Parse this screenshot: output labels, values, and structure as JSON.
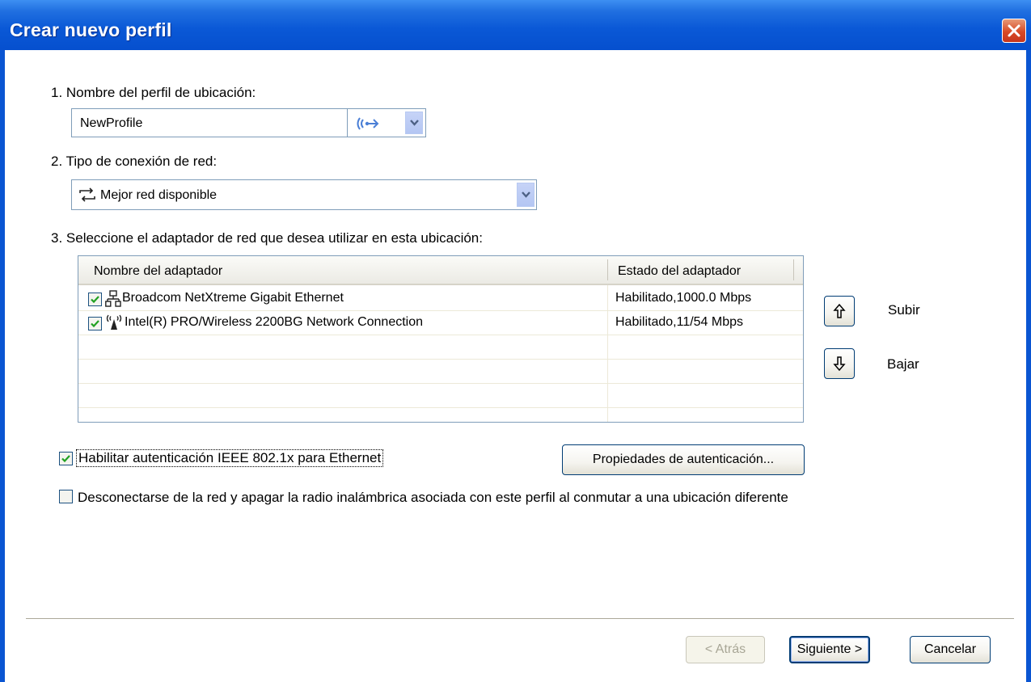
{
  "window": {
    "title": "Crear nuevo perfil"
  },
  "step1": {
    "label": "1. Nombre del perfil de ubicación:",
    "profile_name_value": "NewProfile",
    "icon_selection": "wireless-icon"
  },
  "step2": {
    "label": "2. Tipo de conexión de red:",
    "connection_type_value": "Mejor red disponible"
  },
  "step3": {
    "label": "3. Seleccione el adaptador de red que desea utilizar en esta ubicación:",
    "columns": [
      "Nombre del adaptador",
      "Estado del adaptador"
    ],
    "rows": [
      {
        "checked": true,
        "icon": "ethernet-icon",
        "name": "Broadcom NetXtreme Gigabit Ethernet",
        "status": "Habilitado,1000.0 Mbps"
      },
      {
        "checked": true,
        "icon": "wireless-antenna-icon",
        "name": "Intel(R) PRO/Wireless 2200BG Network Connection",
        "status": "Habilitado,11/54  Mbps"
      }
    ],
    "move_up_label": "Subir",
    "move_down_label": "Bajar"
  },
  "options": {
    "enable_8021x_label": "Habilitar autenticación IEEE 802.1x para Ethernet",
    "enable_8021x_checked": true,
    "auth_properties_button": "Propiedades de autenticación...",
    "disconnect_label": "Desconectarse de la red y apagar la radio inalámbrica asociada con este perfil al conmutar a una ubicación diferente",
    "disconnect_checked": false
  },
  "footer": {
    "back_button": "< Atrás",
    "next_button": "Siguiente >",
    "cancel_button": "Cancelar"
  },
  "colors": {
    "titlebar": "#0a58d6",
    "check": "#21a121"
  }
}
